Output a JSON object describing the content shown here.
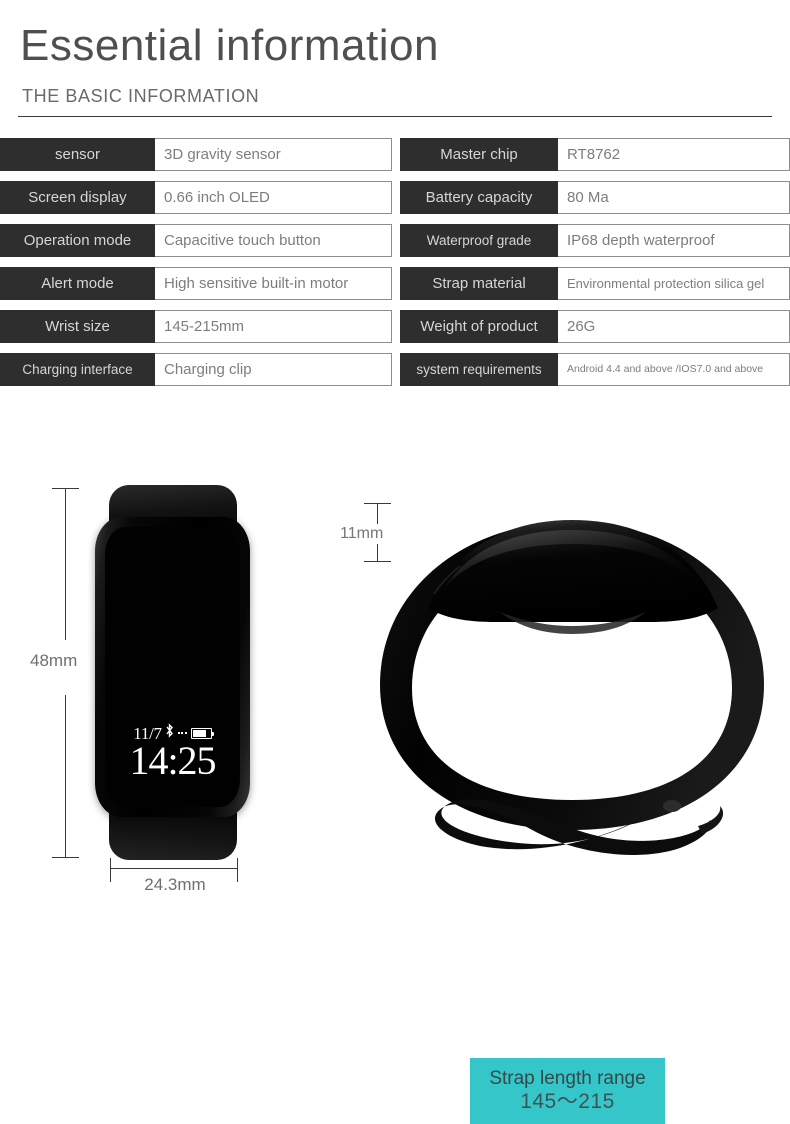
{
  "header": {
    "title": "Essential information",
    "subtitle": "THE BASIC INFORMATION"
  },
  "spec_table": {
    "left_rows": [
      {
        "label": "sensor",
        "value": "3D gravity sensor"
      },
      {
        "label": "Screen display",
        "value": "0.66 inch OLED"
      },
      {
        "label": "Operation mode",
        "value": "Capacitive touch button"
      },
      {
        "label": "Alert mode",
        "value": "High sensitive built-in motor"
      },
      {
        "label": "Wrist size",
        "value": "145-215mm"
      },
      {
        "label": "Charging interface",
        "value": "Charging clip"
      }
    ],
    "right_rows": [
      {
        "label": "Master chip",
        "value": "RT8762"
      },
      {
        "label": "Battery capacity",
        "value": "80 Ma"
      },
      {
        "label": "Waterproof grade",
        "value": "IP68 depth waterproof"
      },
      {
        "label": "Strap material",
        "value": "Environmental protection silica gel"
      },
      {
        "label": "Weight of product",
        "value": "26G"
      },
      {
        "label": "system requirements",
        "value": "Android 4.4 and above /IOS7.0 and above"
      }
    ]
  },
  "figure": {
    "watch_face": {
      "date": "11/7",
      "time": "14:25",
      "bluetooth_icon": "bluetooth-icon",
      "battery_icon": "battery-icon"
    },
    "dimensions": {
      "height": "48mm",
      "width": "24.3mm",
      "thickness": "11mm"
    },
    "strap_callout": {
      "title": "Strap length range",
      "range": "145～215"
    }
  },
  "colors": {
    "label_cell_bg": "#2e2e2e",
    "label_cell_text": "#d6d6d6",
    "value_cell_text": "#7d7d7d",
    "value_cell_border": "#8d8d8d",
    "title_text": "#4f4f4f",
    "callout_bg": "#35c6ca",
    "callout_text": "#35484a",
    "dimension_line": "#3a3a3a",
    "product_black": "#000000"
  }
}
